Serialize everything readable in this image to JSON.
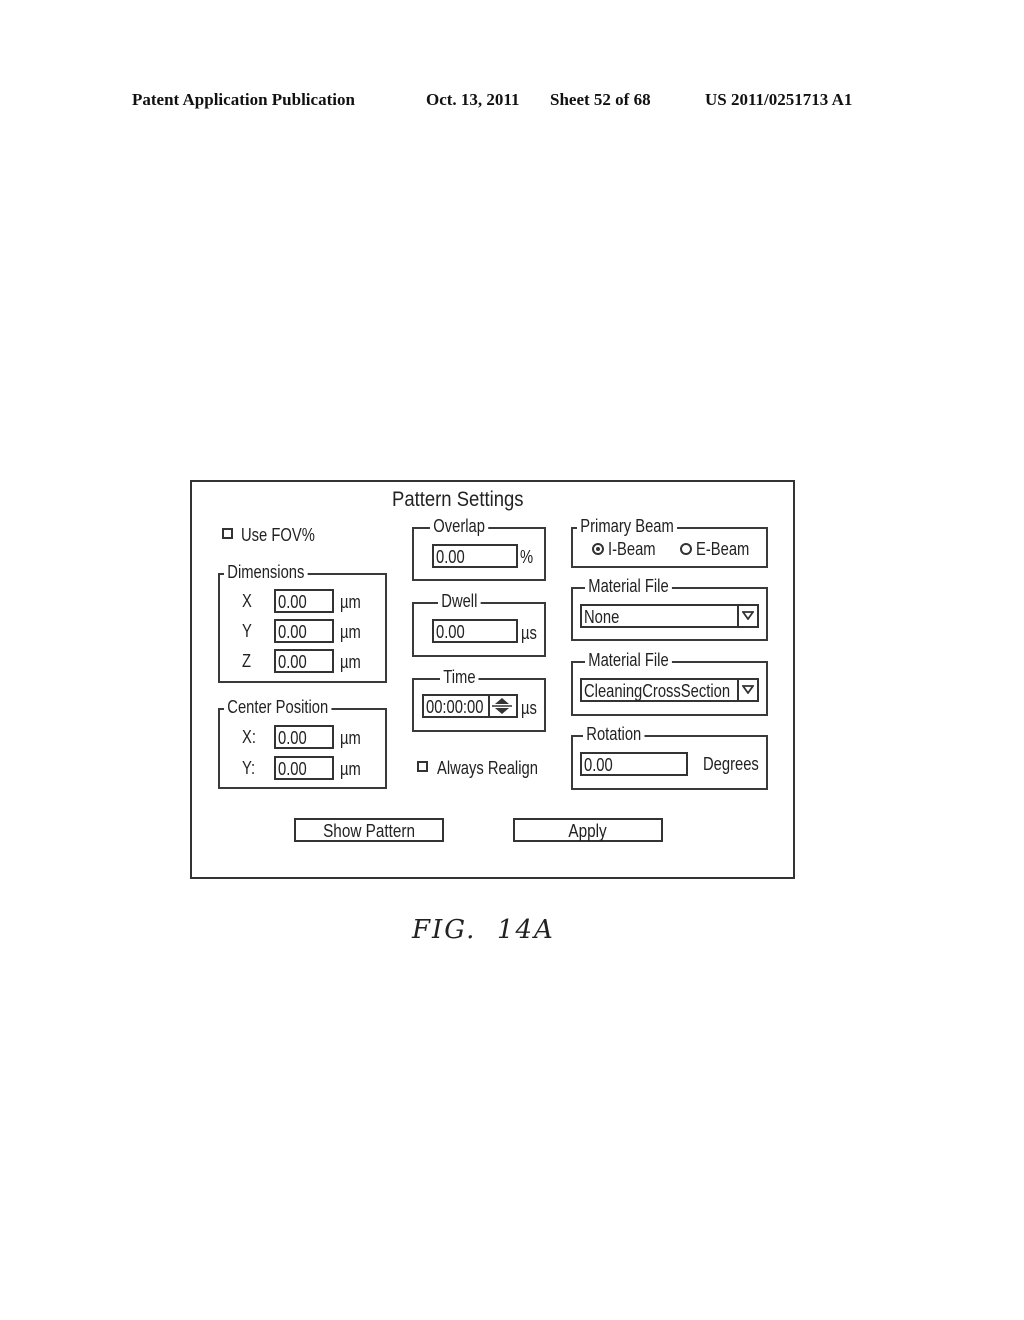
{
  "header": {
    "publication": "Patent Application Publication",
    "date": "Oct. 13, 2011",
    "sheet": "Sheet 52 of 68",
    "number": "US 2011/0251713 A1"
  },
  "dialog": {
    "title": "Pattern Settings",
    "use_fov": {
      "label": "Use FOV%",
      "checked": false
    },
    "dimensions": {
      "legend": "Dimensions",
      "rows": [
        {
          "label": "X",
          "value": "0.00",
          "unit": "µm"
        },
        {
          "label": "Y",
          "value": "0.00",
          "unit": "µm"
        },
        {
          "label": "Z",
          "value": "0.00",
          "unit": "µm"
        }
      ]
    },
    "center_position": {
      "legend": "Center Position",
      "rows": [
        {
          "label": "X:",
          "value": "0.00",
          "unit": "µm"
        },
        {
          "label": "Y:",
          "value": "0.00",
          "unit": "µm"
        }
      ]
    },
    "overlap": {
      "legend": "Overlap",
      "value": "0.00",
      "unit": "%"
    },
    "dwell": {
      "legend": "Dwell",
      "value": "0.00",
      "unit": "µs"
    },
    "time": {
      "legend": "Time",
      "value": "00:00:00",
      "unit": "µs"
    },
    "always_realign": {
      "label": "Always Realign",
      "checked": false
    },
    "primary_beam": {
      "legend": "Primary Beam",
      "options": [
        {
          "label": "I-Beam",
          "selected": true
        },
        {
          "label": "E-Beam",
          "selected": false
        }
      ]
    },
    "material_file_1": {
      "legend": "Material File",
      "value": "None"
    },
    "material_file_2": {
      "legend": "Material File",
      "value": "CleaningCrossSection"
    },
    "rotation": {
      "legend": "Rotation",
      "value": "0.00",
      "unit": "Degrees"
    },
    "buttons": {
      "show_pattern": "Show Pattern",
      "apply": "Apply"
    }
  },
  "figure_label": "FIG.  14A"
}
